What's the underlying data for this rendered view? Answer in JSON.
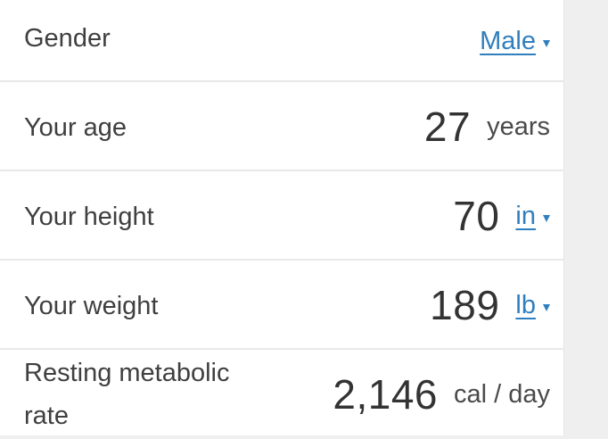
{
  "gender": {
    "label": "Gender",
    "value": "Male"
  },
  "age": {
    "label": "Your age",
    "value": "27",
    "unit": "years"
  },
  "height": {
    "label": "Your height",
    "value": "70",
    "unit": "in"
  },
  "weight": {
    "label": "Your weight",
    "value": "189",
    "unit": "lb"
  },
  "rmr": {
    "label_line1": "Resting metabolic",
    "label_line2": "rate",
    "value": "2,146",
    "unit": "cal / day"
  },
  "colors": {
    "link": "#2f7fbf",
    "divider": "#e8e8e8",
    "side_background": "#efefef"
  }
}
